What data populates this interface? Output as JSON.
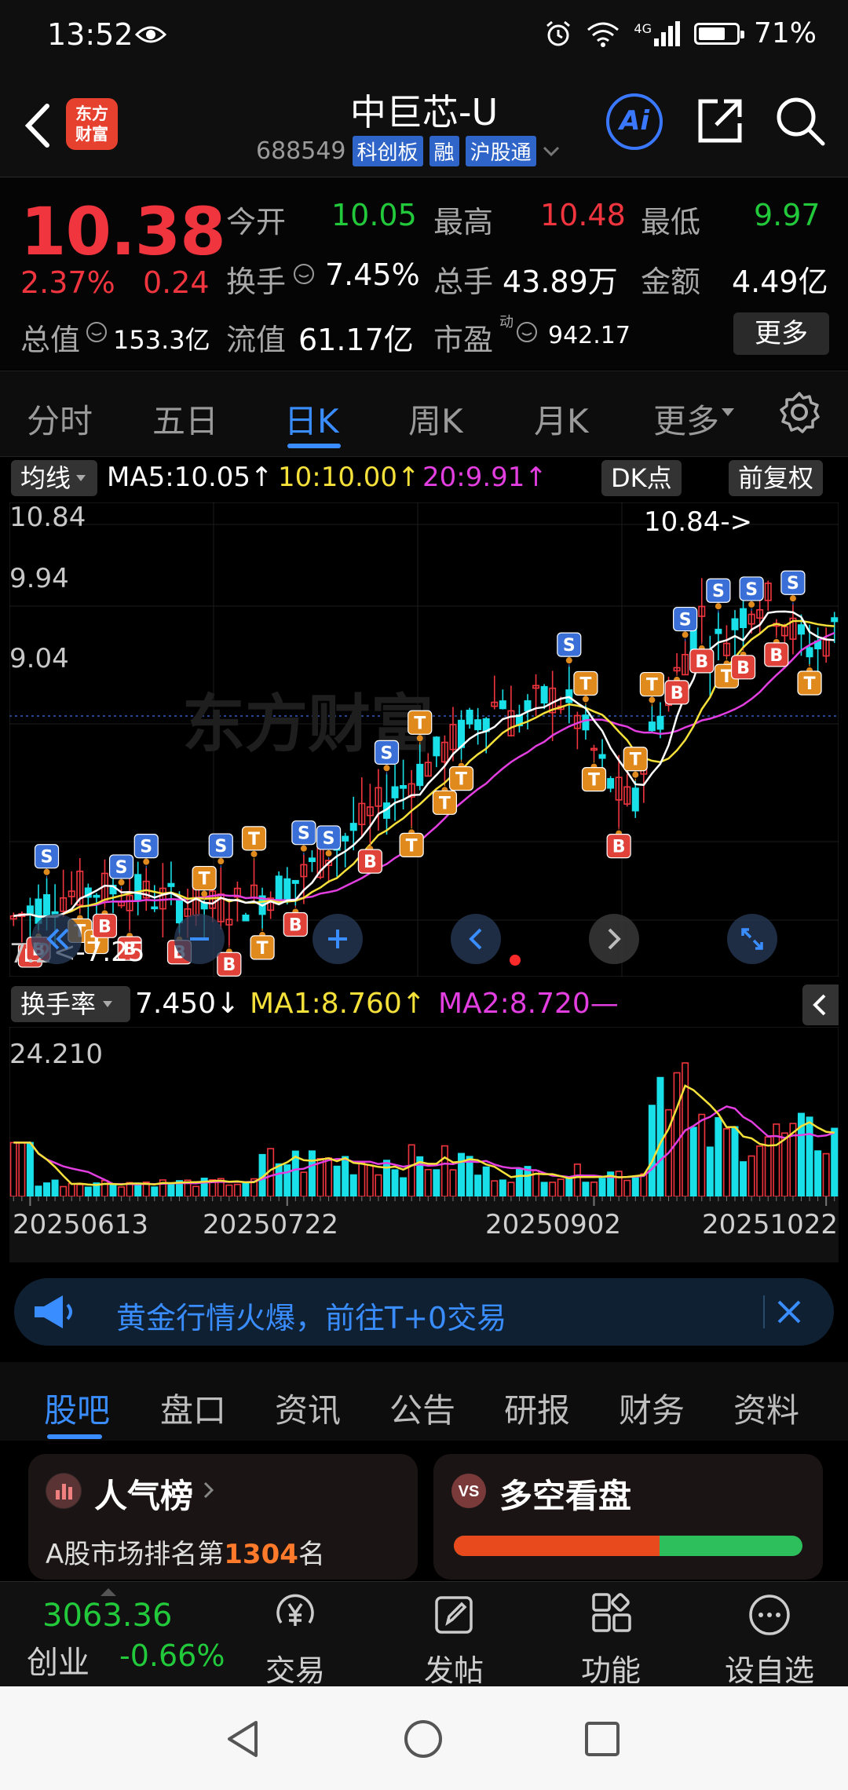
{
  "status_bar": {
    "time": "13:52",
    "signal": "4G",
    "battery": "71%",
    "battery_level": 0.71
  },
  "header": {
    "stock_name": "中巨芯-U",
    "stock_code": "688549",
    "tags": [
      "科创板",
      "融",
      "沪股通"
    ],
    "ai_label": "Ai"
  },
  "quote": {
    "price": "10.38",
    "change_pct": "2.37%",
    "change": "0.24",
    "open_label": "今开",
    "open": "10.05",
    "high_label": "最高",
    "high": "10.48",
    "low_label": "最低",
    "low": "9.97",
    "turnover_label": "换手",
    "turnover": "7.45%",
    "volume_label": "总手",
    "volume": "43.89万",
    "amount_label": "金额",
    "amount": "4.49亿",
    "mktcap_label": "总值",
    "mktcap": "153.3亿",
    "float_label": "流值",
    "float_cap": "61.17亿",
    "pe_label": "市盈",
    "pe_super": "动",
    "pe": "942.17",
    "more_label": "更多"
  },
  "chart_tabs": [
    "分时",
    "五日",
    "日K",
    "周K",
    "月K",
    "更多"
  ],
  "chart_tab_active": 2,
  "chart_bar": {
    "ma_selector": "均线",
    "ma5": "MA5:10.05",
    "ma10": "10:10.00",
    "ma20": "20:9.91",
    "dk_label": "DK点",
    "adjust_label": "前复权"
  },
  "kchart": {
    "y_labels": [
      "10.84",
      "9.94",
      "9.04"
    ],
    "y_low_label": "7.2",
    "high_annotation": "10.84->",
    "low_annotation": "<-7.25",
    "colors": {
      "up": "#f0353f",
      "down": "#19e0e8",
      "ma5": "#ffffff",
      "ma10": "#f5e13a",
      "ma20": "#e23ee0"
    }
  },
  "indicator_bar": {
    "selector": "换手率",
    "value": "7.450",
    "ma1": "MA1:8.760",
    "ma2": "MA2:8.720"
  },
  "vchart": {
    "y_label": "24.210"
  },
  "x_dates": [
    "20250613",
    "20250722",
    "20250902",
    "20251022"
  ],
  "banner": {
    "text": "黄金行情火爆，前往T+0交易"
  },
  "content_tabs": [
    "股吧",
    "盘口",
    "资讯",
    "公告",
    "研报",
    "财务",
    "资料"
  ],
  "content_tab_active": 0,
  "cards": {
    "popularity_title": "人气榜",
    "popularity_desc_prefix": "A股市场排名第",
    "popularity_rank": "1304",
    "popularity_desc_suffix": "名",
    "sentiment_title": "多空看盘",
    "sentiment_bull_ratio": 0.59
  },
  "bottom_nav": {
    "index_value": "3063.36",
    "index_name": "创业",
    "index_change": "-0.66%",
    "items": [
      "交易",
      "发帖",
      "功能",
      "设自选"
    ]
  }
}
